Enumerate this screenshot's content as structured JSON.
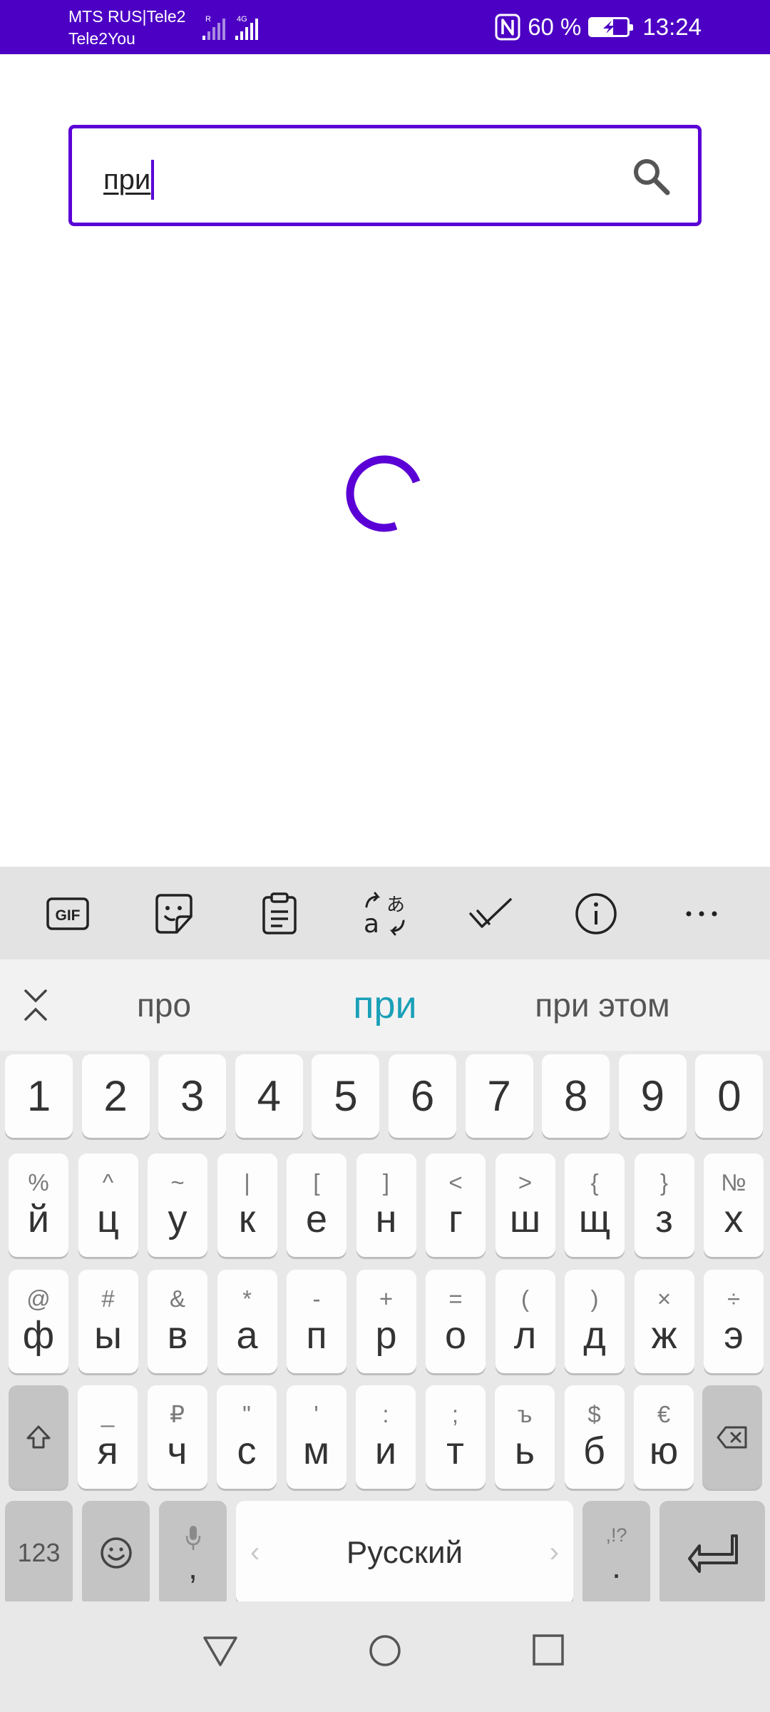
{
  "status_bar": {
    "carrier_line1": "MTS RUS|Tele2",
    "carrier_line2": "Tele2You",
    "sim1_label": "R",
    "sim2_label": "4G",
    "battery_percent": "60 %",
    "battery_level": 0.6,
    "time": "13:24"
  },
  "search": {
    "value": "при"
  },
  "suggestions": [
    "про",
    "при",
    "при этом"
  ],
  "number_row": [
    "1",
    "2",
    "3",
    "4",
    "5",
    "6",
    "7",
    "8",
    "9",
    "0"
  ],
  "row1": [
    {
      "sub": "%",
      "main": "й"
    },
    {
      "sub": "^",
      "main": "ц"
    },
    {
      "sub": "~",
      "main": "у"
    },
    {
      "sub": "|",
      "main": "к"
    },
    {
      "sub": "[",
      "main": "е"
    },
    {
      "sub": "]",
      "main": "н"
    },
    {
      "sub": "<",
      "main": "г"
    },
    {
      "sub": ">",
      "main": "ш"
    },
    {
      "sub": "{",
      "main": "щ"
    },
    {
      "sub": "}",
      "main": "з"
    },
    {
      "sub": "№",
      "main": "х"
    }
  ],
  "row2": [
    {
      "sub": "@",
      "main": "ф"
    },
    {
      "sub": "#",
      "main": "ы"
    },
    {
      "sub": "&",
      "main": "в"
    },
    {
      "sub": "*",
      "main": "а"
    },
    {
      "sub": "-",
      "main": "п"
    },
    {
      "sub": "+",
      "main": "р"
    },
    {
      "sub": "=",
      "main": "о"
    },
    {
      "sub": "(",
      "main": "л"
    },
    {
      "sub": ")",
      "main": "д"
    },
    {
      "sub": "×",
      "main": "ж"
    },
    {
      "sub": "÷",
      "main": "э"
    }
  ],
  "row3": [
    {
      "sub": "_",
      "main": "я"
    },
    {
      "sub": "₽",
      "main": "ч"
    },
    {
      "sub": "\"",
      "main": "с"
    },
    {
      "sub": "'",
      "main": "м"
    },
    {
      "sub": ":",
      "main": "и"
    },
    {
      "sub": ";",
      "main": "т"
    },
    {
      "sub": "ъ",
      "main": "ь"
    },
    {
      "sub": "$",
      "main": "б"
    },
    {
      "sub": "€",
      "main": "ю"
    }
  ],
  "bottom_row": {
    "numbers_label": "123",
    "comma_label": ",",
    "space_label": "Русский",
    "space_left_arrow": "‹",
    "space_right_arrow": "›",
    "period_sub": ",!?",
    "period_label": "."
  },
  "toolbar_icons": [
    "gif-icon",
    "sticker-icon",
    "clipboard-icon",
    "translate-icon",
    "handwriting-icon",
    "info-icon",
    "more-icon"
  ],
  "colors": {
    "accent": "#5a00d6",
    "status_bar": "#4c00c4",
    "suggestion_active": "#1aa0b8"
  }
}
